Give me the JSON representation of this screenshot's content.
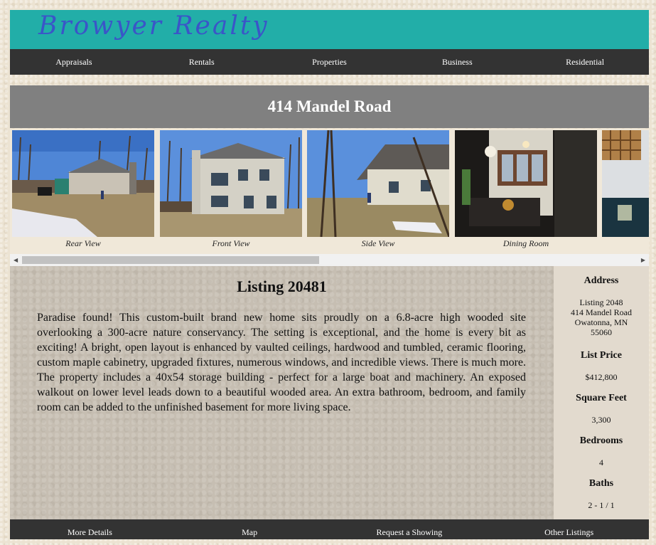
{
  "brand": {
    "name": "Browyer Realty"
  },
  "top_nav": [
    "Appraisals",
    "Rentals",
    "Properties",
    "Business",
    "Residential"
  ],
  "property_title": "414 Mandel Road",
  "gallery": {
    "photos": [
      {
        "caption": "Rear View"
      },
      {
        "caption": "Front View"
      },
      {
        "caption": "Side View"
      },
      {
        "caption": "Dining Room"
      },
      {
        "caption": ""
      }
    ]
  },
  "listing": {
    "heading": "Listing 20481",
    "description": "Paradise found! This custom-built brand new home sits proudly on a 6.8-acre high wooded site overlooking a 300-acre nature conservancy. The setting is exceptional, and the home is every bit as exciting! A bright, open layout is enhanced by vaulted ceilings, hardwood and tumbled, ceramic flooring, custom maple cabinetry, upgraded fixtures, numerous windows, and incredible views. There is much more. The property includes a 40x54 storage building - perfect for a large boat and machinery. An exposed walkout on lower level leads down to a beautiful wooded area. An extra bathroom, bedroom, and family room can be added to the unfinished basement for more living space."
  },
  "details": {
    "address_label": "Address",
    "address_lines": [
      "Listing 2048",
      "414 Mandel Road",
      "Owatonna, MN",
      "55060"
    ],
    "price_label": "List Price",
    "price": "$412,800",
    "sqft_label": "Square Feet",
    "sqft": "3,300",
    "bedrooms_label": "Bedrooms",
    "bedrooms": "4",
    "baths_label": "Baths",
    "baths": "2 - 1 / 1"
  },
  "bottom_nav": [
    "More Details",
    "Map",
    "Request a Showing",
    "Other Listings"
  ],
  "colors": {
    "header": "#22aea8",
    "brand_text": "#3a55c8",
    "nav_bg": "#333333",
    "title_bar": "#808080"
  }
}
